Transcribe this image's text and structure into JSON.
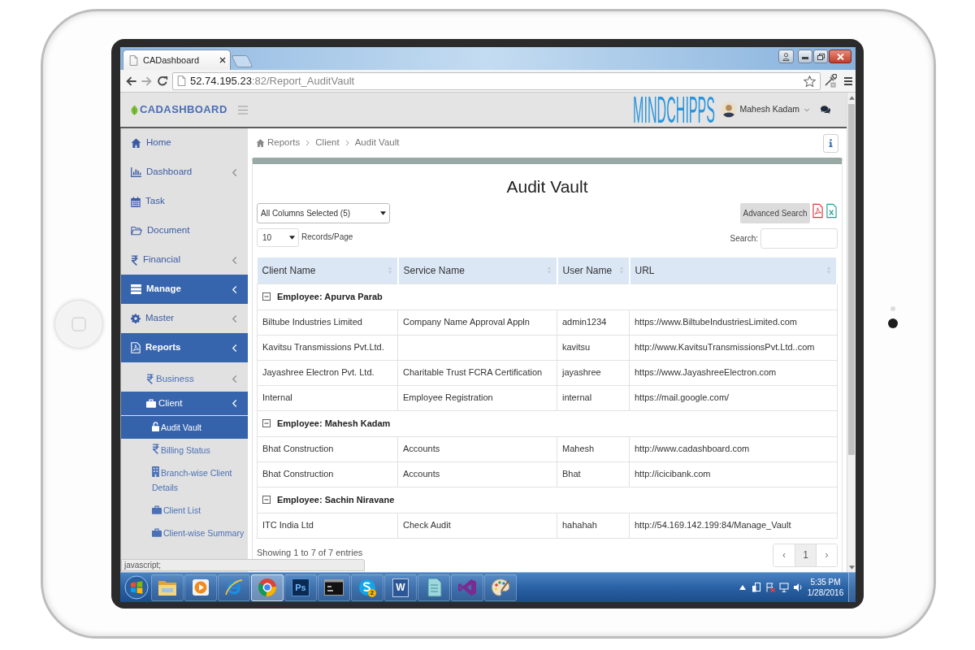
{
  "browser": {
    "tab_title": "CADashboard",
    "url_host": "52.74.195.23",
    "url_path": ":82/Report_AuditVault",
    "status_text": "javascript;"
  },
  "header": {
    "logo_text": "CADASHBOARD",
    "brand_text": "MINDCHIPPS",
    "user_name": "Mahesh Kadam"
  },
  "sidebar": {
    "items": [
      {
        "label": "Home",
        "selected": false,
        "expandable": false
      },
      {
        "label": "Dashboard",
        "selected": false,
        "expandable": true
      },
      {
        "label": "Task",
        "selected": false,
        "expandable": false
      },
      {
        "label": "Document",
        "selected": false,
        "expandable": false
      },
      {
        "label": "Financial",
        "selected": false,
        "expandable": true
      },
      {
        "label": "Manage",
        "selected": true,
        "expandable": true
      },
      {
        "label": "Master",
        "selected": false,
        "expandable": true
      },
      {
        "label": "Reports",
        "selected": true,
        "expandable": true,
        "children": [
          {
            "label": "Business",
            "selected": false,
            "expandable": true
          },
          {
            "label": "Client",
            "selected": true,
            "expandable": true,
            "children": [
              {
                "label": "Audit Vault",
                "selected": true,
                "expandable": false
              },
              {
                "label": "Billing Status",
                "selected": false,
                "expandable": false
              },
              {
                "label": "Branch-wise Client Details",
                "selected": false,
                "expandable": false
              },
              {
                "label": "Client List",
                "selected": false,
                "expandable": false
              },
              {
                "label": "Client-wise Summary",
                "selected": false,
                "expandable": false
              }
            ]
          }
        ]
      }
    ]
  },
  "breadcrumb": [
    "Reports",
    "Client",
    "Audit Vault"
  ],
  "panel": {
    "title": "Audit Vault",
    "columns_select": "All Columns Selected (5)",
    "page_size": "10",
    "page_size_label": "Records/Page",
    "advanced_search_button": "Advanced Search",
    "search_label": "Search:"
  },
  "table": {
    "columns": [
      "Client Name",
      "Service Name",
      "User Name",
      "URL"
    ],
    "groups": [
      {
        "label": "Employee: Apurva Parab",
        "expanded": true,
        "rows": [
          {
            "client_name": "Biltube Industries Limited",
            "service_name": "Company Name Approval Appln",
            "user_name": "admin1234",
            "url": "https://www.BiltubeIndustriesLimited.com"
          },
          {
            "client_name": "Kavitsu Transmissions Pvt.Ltd.",
            "user_name": "kavitsu",
            "url": "http://www.KavitsuTransmissionsPvt.Ltd..com"
          },
          {
            "client_name": "Jayashree Electron Pvt. Ltd.",
            "service_name": "Charitable Trust FCRA Certification",
            "user_name": "jayashree",
            "url": "https://www.JayashreeElectron.com"
          },
          {
            "client_name": "Internal",
            "service_name": "Employee Registration",
            "user_name": "internal",
            "url": "https://mail.google.com/"
          }
        ]
      },
      {
        "label": "Employee: Mahesh Kadam",
        "expanded": true,
        "rows": [
          {
            "client_name": "Bhat Construction",
            "service_name": "Accounts",
            "user_name": "Mahesh",
            "url": "http://www.cadashboard.com"
          },
          {
            "client_name": "Bhat Construction",
            "service_name": "Accounts",
            "user_name": "Bhat",
            "url": "http://icicibank.com"
          }
        ]
      },
      {
        "label": "Employee: Sachin Niravane",
        "expanded": true,
        "rows": [
          {
            "client_name": "ITC India Ltd",
            "service_name": "Check Audit",
            "user_name": "hahahah",
            "url": "http://54.169.142.199:84/Manage_Vault"
          }
        ]
      }
    ]
  },
  "table_info": "Showing 1 to 7 of 7 entries",
  "pagination": [
    {
      "label": "‹",
      "selected": false
    },
    {
      "label": "1",
      "selected": true
    },
    {
      "label": "›",
      "selected": false
    }
  ],
  "taskbar": {
    "apps": [
      {
        "selected": false
      },
      {
        "selected": false
      },
      {
        "selected": false
      },
      {
        "selected": true
      },
      {
        "selected": false,
        "text": "Ps"
      },
      {
        "selected": false
      },
      {
        "selected": false,
        "badge": "2"
      },
      {
        "selected": false,
        "text": "W"
      },
      {
        "selected": false
      },
      {
        "selected": false
      },
      {
        "selected": false
      }
    ],
    "clock_time": "5:35 PM",
    "clock_date": "1/28/2016"
  }
}
